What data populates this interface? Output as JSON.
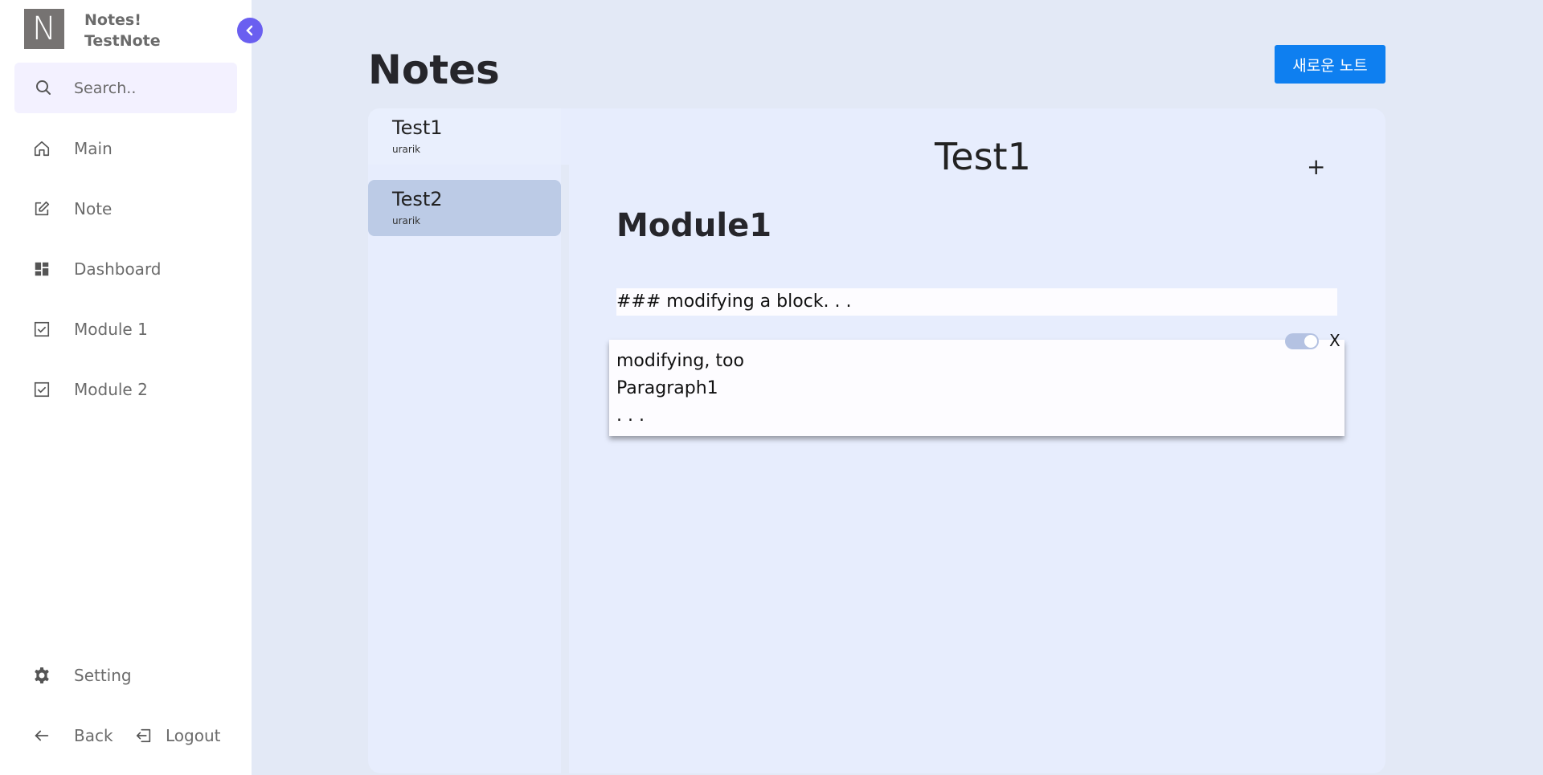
{
  "app": {
    "logo_letter": "N",
    "name": "Notes!",
    "subtitle": "TestNote"
  },
  "search": {
    "placeholder": "Search.."
  },
  "sidebar": {
    "items": [
      {
        "label": "Main",
        "icon": "home-icon"
      },
      {
        "label": "Note",
        "icon": "edit-icon"
      },
      {
        "label": "Dashboard",
        "icon": "dashboard-icon"
      },
      {
        "label": "Module 1",
        "icon": "checkbox-icon"
      },
      {
        "label": "Module 2",
        "icon": "checkbox-icon"
      }
    ],
    "setting_label": "Setting",
    "back_label": "Back",
    "logout_label": "Logout"
  },
  "main": {
    "title": "Notes",
    "new_note_label": "새로운 노트",
    "notes": [
      {
        "title": "Test1",
        "author": "urarik"
      },
      {
        "title": "Test2",
        "author": "urarik"
      }
    ],
    "editor": {
      "note_title": "Test1",
      "add_label": "+",
      "module_title": "Module1",
      "markdown_block": "### modifying a block. . .",
      "editing_block_text": "modifying, too\nParagraph1\n. . .",
      "close_label": "X"
    }
  },
  "colors": {
    "accent": "#6a5ff0",
    "primary_button": "#0e7ff0",
    "selected_note": "#bccbe6"
  }
}
